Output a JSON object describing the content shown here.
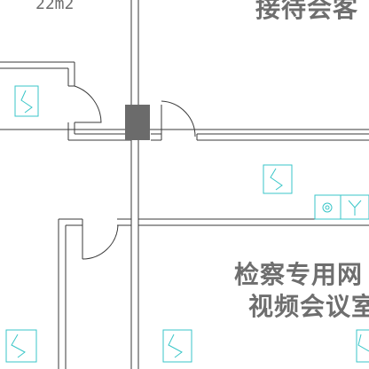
{
  "floor_plan": {
    "area_label": "22m2",
    "room_top_right_name": "接待会客",
    "room_bottom_right_name_line1": "检察专用网",
    "room_bottom_right_name_line2": "视频会议室",
    "colors": {
      "wall": "#3a3a3a",
      "column": "#6b6b6b",
      "fixture": "#39c6c8",
      "text": "#6e6e6e"
    },
    "icons": [
      "outlet-symbol-icon",
      "ceiling-fixture-icon",
      "y-junction-icon"
    ]
  }
}
